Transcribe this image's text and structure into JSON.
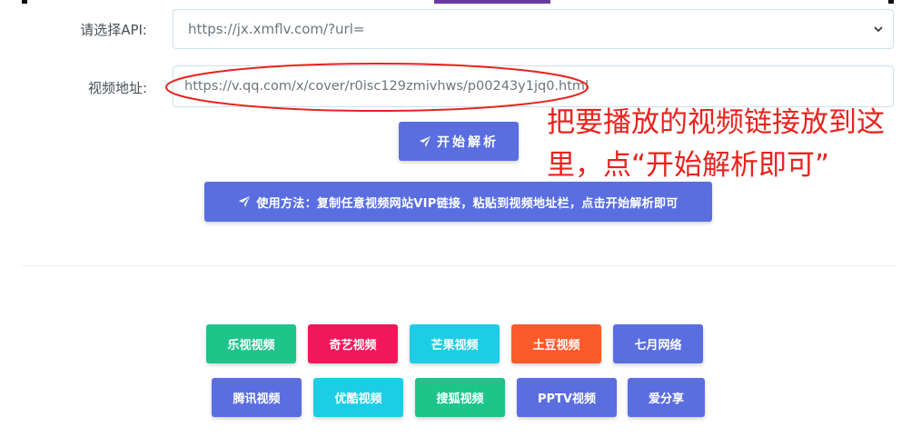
{
  "form": {
    "api_label": "请选择API:",
    "api_selected": "https://jx.xmflv.com/?url=",
    "url_label": "视频地址:",
    "url_value": "https://v.qq.com/x/cover/r0isc129zmivhws/p00243y1jq0.html"
  },
  "actions": {
    "parse_label": "开始解析",
    "usage_label": "使用方法：复制任意视频网站VIP链接，粘贴到视频地址栏，点击开始解析即可"
  },
  "annotation": {
    "line1": "把要播放的视频链接放到这",
    "line2": "里，点“开始解析即可”",
    "color": "#e8231e"
  },
  "sites_row1": [
    {
      "label": "乐视视频",
      "color": "#1fc48b"
    },
    {
      "label": "奇艺视频",
      "color": "#f0185a"
    },
    {
      "label": "芒果视频",
      "color": "#1ccde6"
    },
    {
      "label": "土豆视频",
      "color": "#fb5a2b"
    },
    {
      "label": "七月网络",
      "color": "#5a6ee0"
    }
  ],
  "sites_row2": [
    {
      "label": "腾讯视频",
      "color": "#5a6ee0"
    },
    {
      "label": "优酷视频",
      "color": "#1ccde6"
    },
    {
      "label": "搜狐视频",
      "color": "#1fc48b"
    },
    {
      "label": "PPTV视频",
      "color": "#5a6ee0"
    },
    {
      "label": "爱分享",
      "color": "#5a6ee0"
    }
  ],
  "accent_color": "#5a6ee0"
}
